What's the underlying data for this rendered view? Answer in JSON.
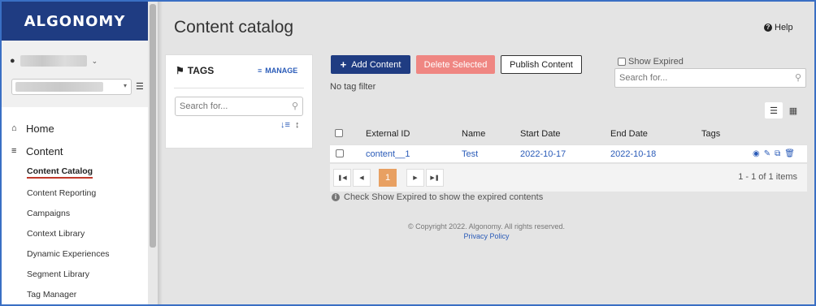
{
  "sidebar": {
    "logo": "ALGONOMY",
    "user_caret": "⌄",
    "nav": [
      {
        "label": "Home",
        "icon": "home-icon"
      },
      {
        "label": "Content",
        "icon": "content-icon"
      }
    ],
    "sub_items": [
      {
        "label": "Content Catalog",
        "active": true
      },
      {
        "label": "Content Reporting"
      },
      {
        "label": "Campaigns"
      },
      {
        "label": "Context Library"
      },
      {
        "label": "Dynamic Experiences"
      },
      {
        "label": "Segment Library"
      },
      {
        "label": "Tag Manager"
      }
    ]
  },
  "header": {
    "title": "Content catalog",
    "help": "Help"
  },
  "tags_panel": {
    "title": "TAGS",
    "manage": "MANAGE",
    "search_placeholder": "Search for..."
  },
  "toolbar": {
    "add": "Add Content",
    "delete": "Delete Selected",
    "publish": "Publish Content",
    "no_tag_filter": "No tag filter",
    "show_expired": "Show Expired",
    "search_placeholder": "Search for..."
  },
  "table": {
    "columns": [
      "External ID",
      "Name",
      "Start Date",
      "End Date",
      "Tags"
    ],
    "rows": [
      {
        "external_id": "content__1",
        "name": "Test",
        "start_date": "2022-10-17",
        "end_date": "2022-10-18",
        "tags": ""
      }
    ]
  },
  "pager": {
    "current_page": "1",
    "info": "1 - 1 of 1 items"
  },
  "note": "Check Show Expired to show the expired contents",
  "footer": {
    "copyright": "© Copyright 2022. Algonomy. All rights reserved.",
    "privacy": "Privacy Policy"
  },
  "colors": {
    "brand": "#1f3c82",
    "danger": "#ef8682",
    "link": "#2a5bb8",
    "page_active": "#e8a062"
  }
}
